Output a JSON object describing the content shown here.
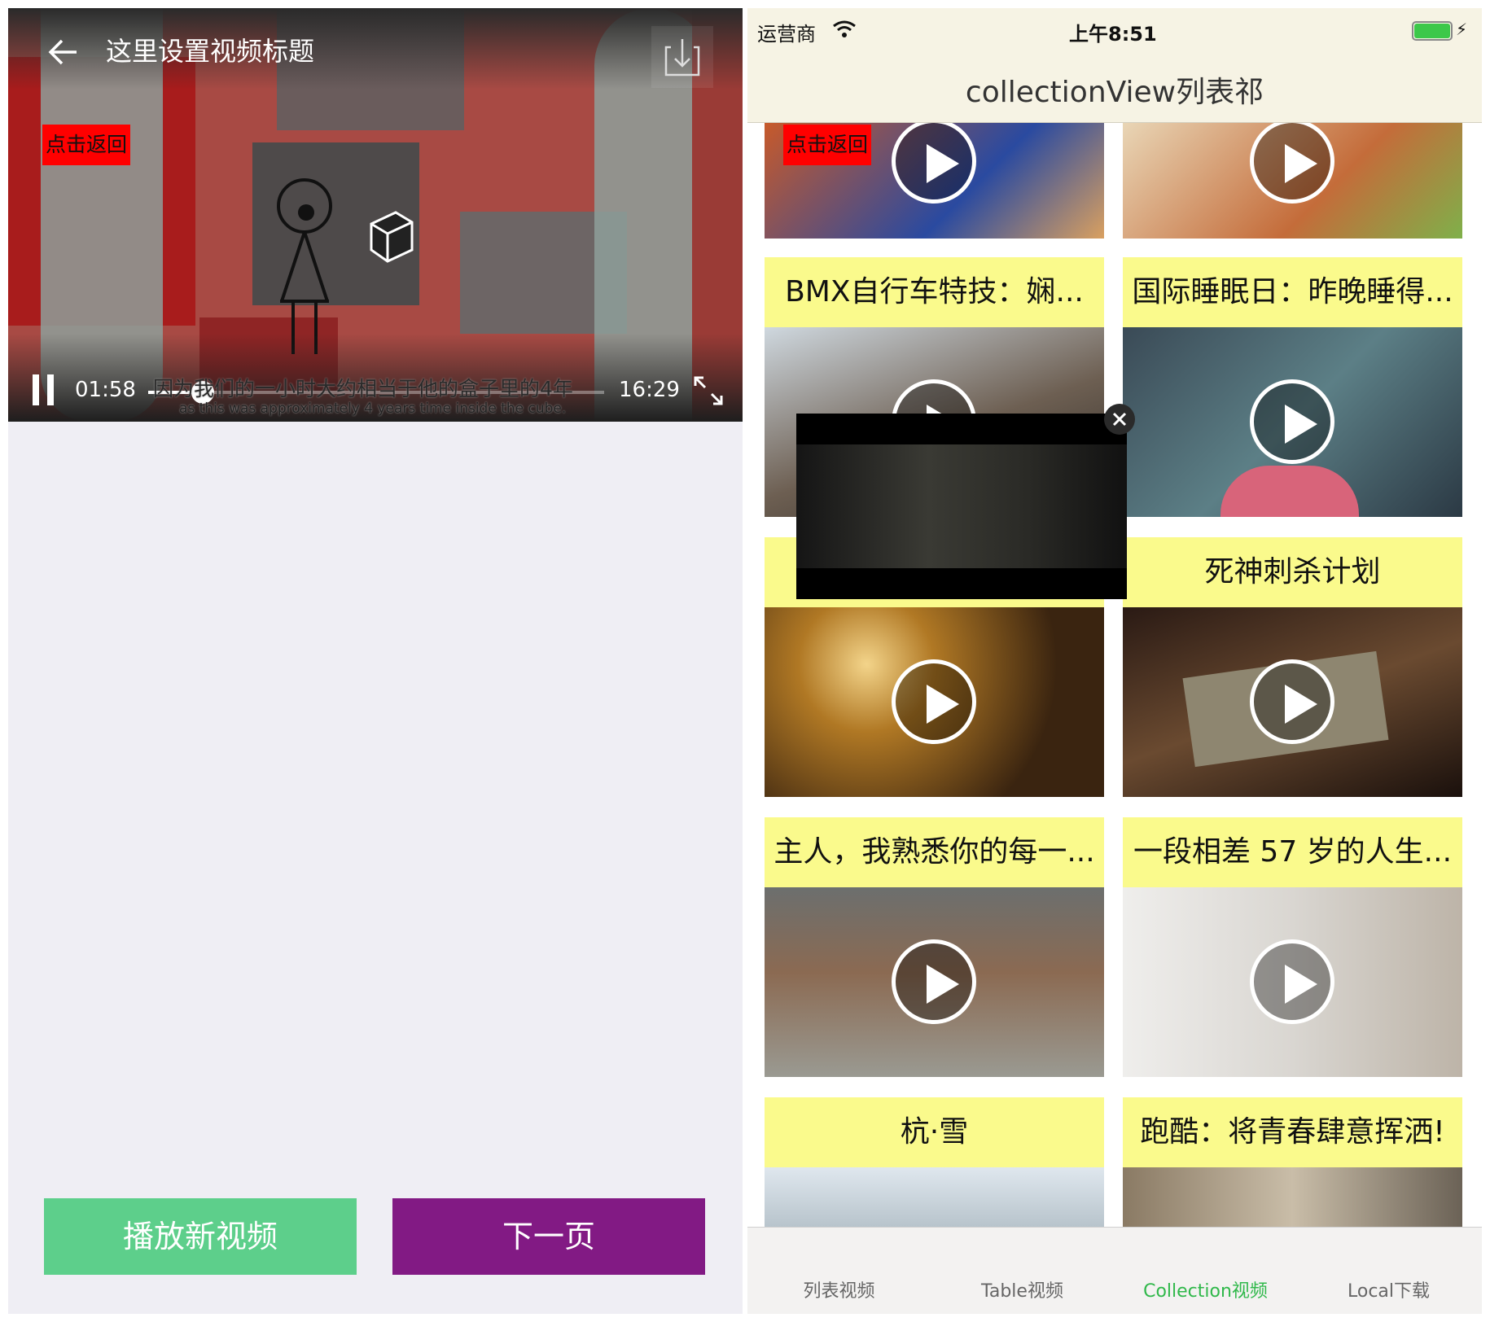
{
  "left_screen": {
    "player": {
      "title": "这里设置视频标题",
      "back_label": "点击返回",
      "current_time": "01:58",
      "total_time": "16:29",
      "progress": 0.12,
      "subtitle_cn": "因为我们的一小时大约相当于他的盒子里的4年",
      "subtitle_en": "as this was approximately 4 years time inside the cube."
    },
    "buttons": {
      "play_new": "播放新视频",
      "next_page": "下一页"
    }
  },
  "right_screen": {
    "status_bar": {
      "carrier": "运营商",
      "time": "上午8:51"
    },
    "nav_title": "collectionView列表祁",
    "back_label": "点击返回",
    "cards": [
      {
        "title": ""
      },
      {
        "title": ""
      },
      {
        "title": "BMX自行车特技：娴..."
      },
      {
        "title": "国际睡眠日：昨晚睡得..."
      },
      {
        "title": ""
      },
      {
        "title": "死神刺杀计划"
      },
      {
        "title": "主人，我熟悉你的每一..."
      },
      {
        "title": "一段相差 57 岁的人生..."
      },
      {
        "title": "杭·雪"
      },
      {
        "title": "跑酷：将青春肆意挥洒!"
      }
    ],
    "tabs": [
      "列表视频",
      "Table视频",
      "Collection视频",
      "Local下载"
    ],
    "active_tab_color": "#2fb84a"
  }
}
